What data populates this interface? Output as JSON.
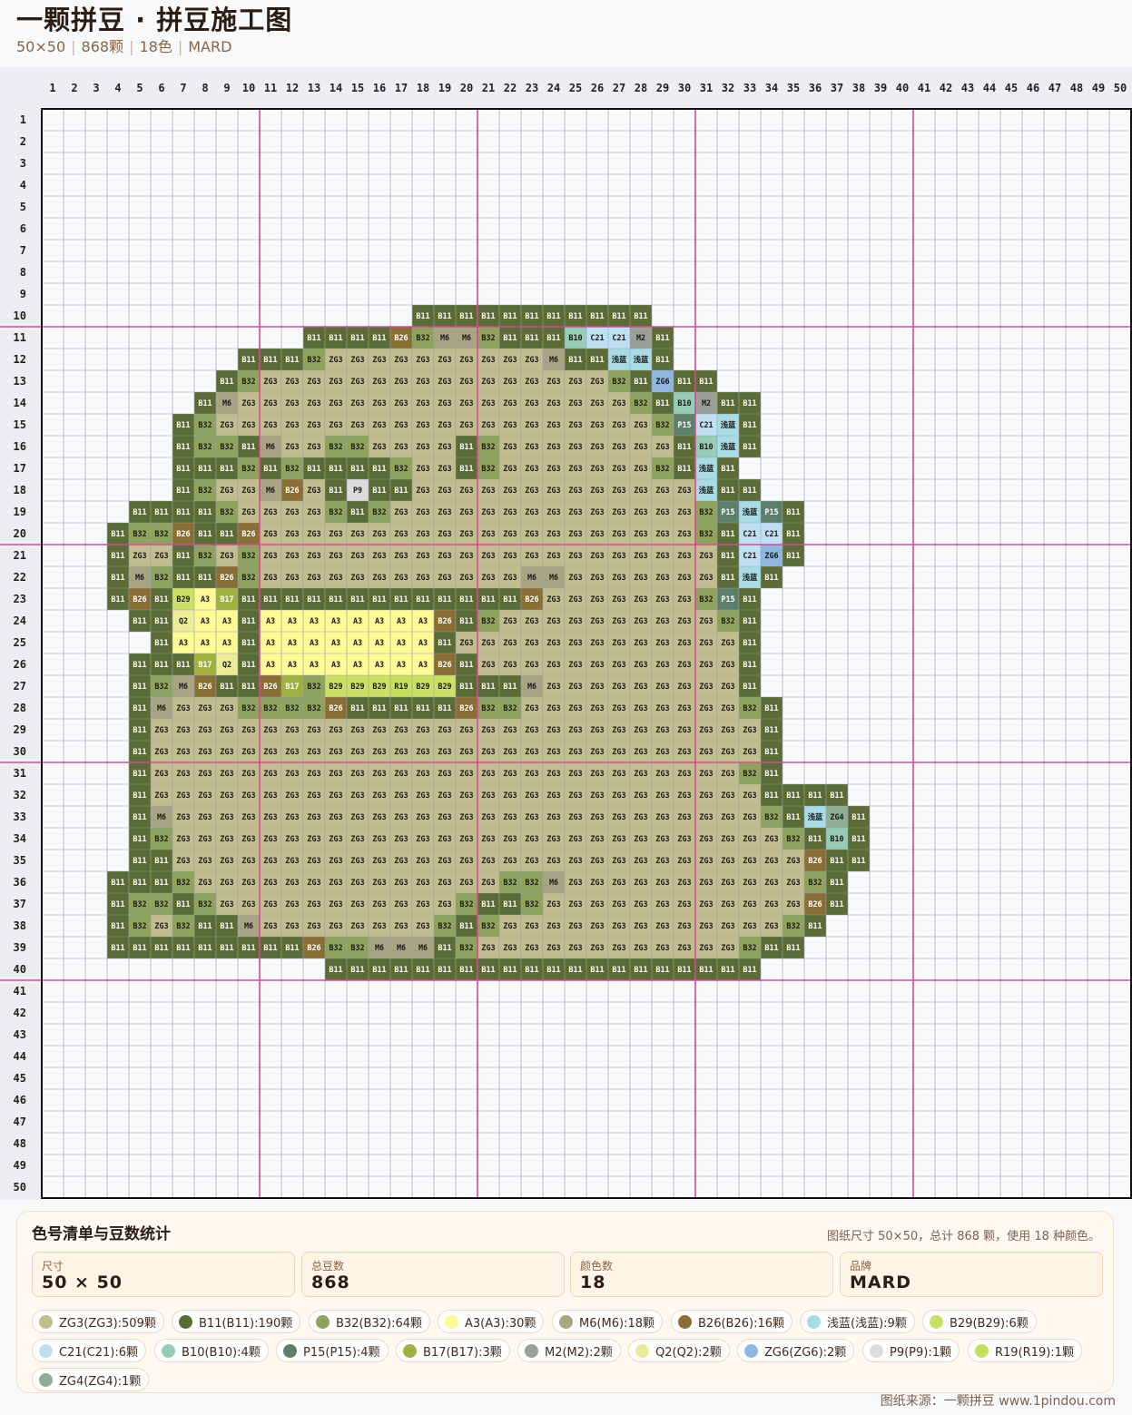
{
  "header": {
    "title": "一颗拼豆 · 拼豆施工图",
    "size": "50×50",
    "bead_count": "868颗",
    "color_count": "18色",
    "brand": "MARD"
  },
  "grid": {
    "cols": 50,
    "rows": 50,
    "major_every": 10,
    "rows_data": [
      {
        "r": 10,
        "c": 18,
        "cells": [
          "B11",
          "B11",
          "B11",
          "B11",
          "B11",
          "B11",
          "B11",
          "B11",
          "B11",
          "B11",
          "B11"
        ]
      },
      {
        "r": 11,
        "c": 13,
        "cells": [
          "B11",
          "B11",
          "B11",
          "B11",
          "B26",
          "B32",
          "M6",
          "M6",
          "B32",
          "B11",
          "B11",
          "B11",
          "B10",
          "C21",
          "C21",
          "M2",
          "B11"
        ]
      },
      {
        "r": 12,
        "c": 10,
        "cells": [
          "B11",
          "B11",
          "B11",
          "B32",
          "ZG3",
          "ZG3",
          "ZG3",
          "ZG3",
          "ZG3",
          "ZG3",
          "ZG3",
          "ZG3",
          "ZG3",
          "ZG3",
          "M6",
          "B11",
          "B11",
          "浅蓝",
          "浅蓝",
          "B11"
        ]
      },
      {
        "r": 13,
        "c": 9,
        "cells": [
          "B11",
          "B32",
          "ZG3",
          "ZG3",
          "ZG3",
          "ZG3",
          "ZG3",
          "ZG3",
          "ZG3",
          "ZG3",
          "ZG3",
          "ZG3",
          "ZG3",
          "ZG3",
          "ZG3",
          "ZG3",
          "ZG3",
          "ZG3",
          "B32",
          "B11",
          "ZG6",
          "B11",
          "B11"
        ]
      },
      {
        "r": 14,
        "c": 8,
        "cells": [
          "B11",
          "M6",
          "ZG3",
          "ZG3",
          "ZG3",
          "ZG3",
          "ZG3",
          "ZG3",
          "ZG3",
          "ZG3",
          "ZG3",
          "ZG3",
          "ZG3",
          "ZG3",
          "ZG3",
          "ZG3",
          "ZG3",
          "ZG3",
          "ZG3",
          "ZG3",
          "B32",
          "B11",
          "B10",
          "M2",
          "B11",
          "B11"
        ]
      },
      {
        "r": 15,
        "c": 7,
        "cells": [
          "B11",
          "B32",
          "ZG3",
          "ZG3",
          "ZG3",
          "ZG3",
          "ZG3",
          "ZG3",
          "ZG3",
          "ZG3",
          "ZG3",
          "ZG3",
          "ZG3",
          "ZG3",
          "ZG3",
          "ZG3",
          "ZG3",
          "ZG3",
          "ZG3",
          "ZG3",
          "ZG3",
          "ZG3",
          "B32",
          "P15",
          "C21",
          "浅蓝",
          "B11"
        ]
      },
      {
        "r": 16,
        "c": 7,
        "cells": [
          "B11",
          "B32",
          "B32",
          "B11",
          "M6",
          "ZG3",
          "ZG3",
          "B32",
          "B32",
          "ZG3",
          "ZG3",
          "ZG3",
          "ZG3",
          "B11",
          "B32",
          "ZG3",
          "ZG3",
          "ZG3",
          "ZG3",
          "ZG3",
          "ZG3",
          "ZG3",
          "ZG3",
          "B11",
          "B10",
          "浅蓝",
          "B11"
        ]
      },
      {
        "r": 17,
        "c": 7,
        "cells": [
          "B11",
          "B11",
          "B11",
          "B32",
          "B11",
          "B32",
          "B11",
          "B11",
          "B11",
          "B11",
          "B32",
          "ZG3",
          "ZG3",
          "B11",
          "B32",
          "ZG3",
          "ZG3",
          "ZG3",
          "ZG3",
          "ZG3",
          "ZG3",
          "ZG3",
          "B32",
          "B11",
          "浅蓝",
          "B11"
        ]
      },
      {
        "r": 18,
        "c": 7,
        "cells": [
          "B11",
          "B32",
          "ZG3",
          "ZG3",
          "M6",
          "B26",
          "ZG3",
          "B11",
          "P9",
          "B11",
          "B11",
          "ZG3",
          "ZG3",
          "ZG3",
          "ZG3",
          "ZG3",
          "ZG3",
          "ZG3",
          "ZG3",
          "ZG3",
          "ZG3",
          "ZG3",
          "ZG3",
          "ZG3",
          "浅蓝",
          "B11",
          "B11"
        ]
      },
      {
        "r": 19,
        "c": 5,
        "cells": [
          "B11",
          "B11",
          "B11",
          "B11",
          "B32",
          "ZG3",
          "ZG3",
          "ZG3",
          "ZG3",
          "B32",
          "B11",
          "B32",
          "ZG3",
          "ZG3",
          "ZG3",
          "ZG3",
          "ZG3",
          "ZG3",
          "ZG3",
          "ZG3",
          "ZG3",
          "ZG3",
          "ZG3",
          "ZG3",
          "ZG3",
          "ZG3",
          "B32",
          "P15",
          "浅蓝",
          "P15",
          "B11"
        ]
      },
      {
        "r": 20,
        "c": 4,
        "cells": [
          "B11",
          "B32",
          "B32",
          "B26",
          "B11",
          "B11",
          "B26",
          "ZG3",
          "ZG3",
          "ZG3",
          "ZG3",
          "ZG3",
          "ZG3",
          "ZG3",
          "ZG3",
          "ZG3",
          "ZG3",
          "ZG3",
          "ZG3",
          "ZG3",
          "ZG3",
          "ZG3",
          "ZG3",
          "ZG3",
          "ZG3",
          "ZG3",
          "ZG3",
          "B32",
          "B11",
          "C21",
          "C21",
          "B11"
        ]
      },
      {
        "r": 21,
        "c": 4,
        "cells": [
          "B11",
          "ZG3",
          "ZG3",
          "B11",
          "B32",
          "ZG3",
          "B32",
          "ZG3",
          "ZG3",
          "ZG3",
          "ZG3",
          "ZG3",
          "ZG3",
          "ZG3",
          "ZG3",
          "ZG3",
          "ZG3",
          "ZG3",
          "ZG3",
          "ZG3",
          "ZG3",
          "ZG3",
          "ZG3",
          "ZG3",
          "ZG3",
          "ZG3",
          "ZG3",
          "ZG3",
          "B11",
          "C21",
          "ZG6",
          "B11"
        ]
      },
      {
        "r": 22,
        "c": 4,
        "cells": [
          "B11",
          "M6",
          "B32",
          "B11",
          "B11",
          "B26",
          "B32",
          "ZG3",
          "ZG3",
          "ZG3",
          "ZG3",
          "ZG3",
          "ZG3",
          "ZG3",
          "ZG3",
          "ZG3",
          "ZG3",
          "ZG3",
          "ZG3",
          "M6",
          "M6",
          "ZG3",
          "ZG3",
          "ZG3",
          "ZG3",
          "ZG3",
          "ZG3",
          "ZG3",
          "B11",
          "浅蓝",
          "B11"
        ]
      },
      {
        "r": 23,
        "c": 4,
        "cells": [
          "B11",
          "B26",
          "B11",
          "B29",
          "A3",
          "B17",
          "B11",
          "B11",
          "B11",
          "B11",
          "B11",
          "B11",
          "B11",
          "B11",
          "B11",
          "B11",
          "B11",
          "B11",
          "B11",
          "B26",
          "ZG3",
          "ZG3",
          "ZG3",
          "ZG3",
          "ZG3",
          "ZG3",
          "ZG3",
          "B32",
          "P15",
          "B11"
        ]
      },
      {
        "r": 24,
        "c": 5,
        "cells": [
          "B11",
          "B11",
          "Q2",
          "A3",
          "A3",
          "B11",
          "A3",
          "A3",
          "A3",
          "A3",
          "A3",
          "A3",
          "A3",
          "A3",
          "B26",
          "B11",
          "B32",
          "ZG3",
          "ZG3",
          "ZG3",
          "ZG3",
          "ZG3",
          "ZG3",
          "ZG3",
          "ZG3",
          "ZG3",
          "ZG3",
          "B32",
          "B11"
        ]
      },
      {
        "r": 25,
        "c": 6,
        "cells": [
          "B11",
          "A3",
          "A3",
          "A3",
          "B11",
          "A3",
          "A3",
          "A3",
          "A3",
          "A3",
          "A3",
          "A3",
          "A3",
          "B11",
          "ZG3",
          "ZG3",
          "ZG3",
          "ZG3",
          "ZG3",
          "ZG3",
          "ZG3",
          "ZG3",
          "ZG3",
          "ZG3",
          "ZG3",
          "ZG3",
          "ZG3",
          "B11"
        ]
      },
      {
        "r": 26,
        "c": 5,
        "cells": [
          "B11",
          "B11",
          "B11",
          "B17",
          "Q2",
          "B11",
          "A3",
          "A3",
          "A3",
          "A3",
          "A3",
          "A3",
          "A3",
          "A3",
          "B26",
          "B11",
          "ZG3",
          "ZG3",
          "ZG3",
          "ZG3",
          "ZG3",
          "ZG3",
          "ZG3",
          "ZG3",
          "ZG3",
          "ZG3",
          "ZG3",
          "ZG3",
          "B11"
        ]
      },
      {
        "r": 27,
        "c": 5,
        "cells": [
          "B11",
          "B32",
          "M6",
          "B26",
          "B11",
          "B11",
          "B26",
          "B17",
          "B32",
          "B29",
          "B29",
          "B29",
          "R19",
          "B29",
          "B29",
          "B11",
          "B11",
          "B11",
          "M6",
          "ZG3",
          "ZG3",
          "ZG3",
          "ZG3",
          "ZG3",
          "ZG3",
          "ZG3",
          "ZG3",
          "ZG3",
          "B11"
        ]
      },
      {
        "r": 28,
        "c": 5,
        "cells": [
          "B11",
          "M6",
          "ZG3",
          "ZG3",
          "ZG3",
          "B32",
          "B32",
          "B32",
          "B32",
          "B26",
          "B11",
          "B11",
          "B11",
          "B11",
          "B11",
          "B26",
          "B32",
          "B32",
          "ZG3",
          "ZG3",
          "ZG3",
          "ZG3",
          "ZG3",
          "ZG3",
          "ZG3",
          "ZG3",
          "ZG3",
          "ZG3",
          "B32",
          "B11"
        ]
      },
      {
        "r": 29,
        "c": 5,
        "cells": [
          "B11",
          "ZG3",
          "ZG3",
          "ZG3",
          "ZG3",
          "ZG3",
          "ZG3",
          "ZG3",
          "ZG3",
          "ZG3",
          "ZG3",
          "ZG3",
          "ZG3",
          "ZG3",
          "ZG3",
          "ZG3",
          "ZG3",
          "ZG3",
          "ZG3",
          "ZG3",
          "ZG3",
          "ZG3",
          "ZG3",
          "ZG3",
          "ZG3",
          "ZG3",
          "ZG3",
          "ZG3",
          "ZG3",
          "B11"
        ]
      },
      {
        "r": 30,
        "c": 5,
        "cells": [
          "B11",
          "ZG3",
          "ZG3",
          "ZG3",
          "ZG3",
          "ZG3",
          "ZG3",
          "ZG3",
          "ZG3",
          "ZG3",
          "ZG3",
          "ZG3",
          "ZG3",
          "ZG3",
          "ZG3",
          "ZG3",
          "ZG3",
          "ZG3",
          "ZG3",
          "ZG3",
          "ZG3",
          "ZG3",
          "ZG3",
          "ZG3",
          "ZG3",
          "ZG3",
          "ZG3",
          "ZG3",
          "ZG3",
          "B11"
        ]
      },
      {
        "r": 31,
        "c": 5,
        "cells": [
          "B11",
          "ZG3",
          "ZG3",
          "ZG3",
          "ZG3",
          "ZG3",
          "ZG3",
          "ZG3",
          "ZG3",
          "ZG3",
          "ZG3",
          "ZG3",
          "ZG3",
          "ZG3",
          "ZG3",
          "ZG3",
          "ZG3",
          "ZG3",
          "ZG3",
          "ZG3",
          "ZG3",
          "ZG3",
          "ZG3",
          "ZG3",
          "ZG3",
          "ZG3",
          "ZG3",
          "ZG3",
          "B32",
          "B11"
        ]
      },
      {
        "r": 32,
        "c": 5,
        "cells": [
          "B11",
          "ZG3",
          "ZG3",
          "ZG3",
          "ZG3",
          "ZG3",
          "ZG3",
          "ZG3",
          "ZG3",
          "ZG3",
          "ZG3",
          "ZG3",
          "ZG3",
          "ZG3",
          "ZG3",
          "ZG3",
          "ZG3",
          "ZG3",
          "ZG3",
          "ZG3",
          "ZG3",
          "ZG3",
          "ZG3",
          "ZG3",
          "ZG3",
          "ZG3",
          "ZG3",
          "ZG3",
          "ZG3",
          "B11",
          "B11",
          "B11",
          "B11"
        ]
      },
      {
        "r": 33,
        "c": 5,
        "cells": [
          "B11",
          "M6",
          "ZG3",
          "ZG3",
          "ZG3",
          "ZG3",
          "ZG3",
          "ZG3",
          "ZG3",
          "ZG3",
          "ZG3",
          "ZG3",
          "ZG3",
          "ZG3",
          "ZG3",
          "ZG3",
          "ZG3",
          "ZG3",
          "ZG3",
          "ZG3",
          "ZG3",
          "ZG3",
          "ZG3",
          "ZG3",
          "ZG3",
          "ZG3",
          "ZG3",
          "ZG3",
          "ZG3",
          "B32",
          "B11",
          "浅蓝",
          "ZG4",
          "B11"
        ]
      },
      {
        "r": 34,
        "c": 5,
        "cells": [
          "B11",
          "B32",
          "ZG3",
          "ZG3",
          "ZG3",
          "ZG3",
          "ZG3",
          "ZG3",
          "ZG3",
          "ZG3",
          "ZG3",
          "ZG3",
          "ZG3",
          "ZG3",
          "ZG3",
          "ZG3",
          "ZG3",
          "ZG3",
          "ZG3",
          "ZG3",
          "ZG3",
          "ZG3",
          "ZG3",
          "ZG3",
          "ZG3",
          "ZG3",
          "ZG3",
          "ZG3",
          "ZG3",
          "ZG3",
          "B32",
          "B11",
          "B10",
          "B11"
        ]
      },
      {
        "r": 35,
        "c": 5,
        "cells": [
          "B11",
          "B11",
          "ZG3",
          "ZG3",
          "ZG3",
          "ZG3",
          "ZG3",
          "ZG3",
          "ZG3",
          "ZG3",
          "ZG3",
          "ZG3",
          "ZG3",
          "ZG3",
          "ZG3",
          "ZG3",
          "ZG3",
          "ZG3",
          "ZG3",
          "ZG3",
          "ZG3",
          "ZG3",
          "ZG3",
          "ZG3",
          "ZG3",
          "ZG3",
          "ZG3",
          "ZG3",
          "ZG3",
          "ZG3",
          "ZG3",
          "B26",
          "B11",
          "B11"
        ]
      },
      {
        "r": 36,
        "c": 4,
        "cells": [
          "B11",
          "B11",
          "B11",
          "B32",
          "ZG3",
          "ZG3",
          "ZG3",
          "ZG3",
          "ZG3",
          "ZG3",
          "ZG3",
          "ZG3",
          "ZG3",
          "ZG3",
          "ZG3",
          "ZG3",
          "ZG3",
          "ZG3",
          "B32",
          "B32",
          "M6",
          "ZG3",
          "ZG3",
          "ZG3",
          "ZG3",
          "ZG3",
          "ZG3",
          "ZG3",
          "ZG3",
          "ZG3",
          "ZG3",
          "ZG3",
          "B32",
          "B11"
        ]
      },
      {
        "r": 37,
        "c": 4,
        "cells": [
          "B11",
          "B32",
          "B32",
          "B11",
          "B32",
          "ZG3",
          "ZG3",
          "ZG3",
          "ZG3",
          "ZG3",
          "ZG3",
          "ZG3",
          "ZG3",
          "ZG3",
          "ZG3",
          "ZG3",
          "B32",
          "B11",
          "B11",
          "B32",
          "ZG3",
          "ZG3",
          "ZG3",
          "ZG3",
          "ZG3",
          "ZG3",
          "ZG3",
          "ZG3",
          "ZG3",
          "ZG3",
          "ZG3",
          "ZG3",
          "B26",
          "B11"
        ]
      },
      {
        "r": 38,
        "c": 4,
        "cells": [
          "B11",
          "B32",
          "ZG3",
          "B32",
          "B11",
          "B11",
          "M6",
          "ZG3",
          "ZG3",
          "ZG3",
          "ZG3",
          "ZG3",
          "ZG3",
          "ZG3",
          "ZG3",
          "B32",
          "B11",
          "B32",
          "ZG3",
          "ZG3",
          "ZG3",
          "ZG3",
          "ZG3",
          "ZG3",
          "ZG3",
          "ZG3",
          "ZG3",
          "ZG3",
          "ZG3",
          "ZG3",
          "ZG3",
          "B32",
          "B11"
        ]
      },
      {
        "r": 39,
        "c": 4,
        "cells": [
          "B11",
          "B11",
          "B11",
          "B11",
          "B11",
          "B11",
          "B11",
          "B11",
          "B11",
          "B26",
          "B32",
          "B32",
          "M6",
          "M6",
          "M6",
          "B11",
          "B32",
          "ZG3",
          "ZG3",
          "ZG3",
          "ZG3",
          "ZG3",
          "ZG3",
          "ZG3",
          "ZG3",
          "ZG3",
          "ZG3",
          "ZG3",
          "ZG3",
          "B32",
          "B11",
          "B11"
        ]
      },
      {
        "r": 40,
        "c": 14,
        "cells": [
          "B11",
          "B11",
          "B11",
          "B11",
          "B11",
          "B11",
          "B11",
          "B11",
          "B11",
          "B11",
          "B11",
          "B11",
          "B11",
          "B11",
          "B11",
          "B11",
          "B11",
          "B11",
          "B11",
          "B11"
        ]
      }
    ]
  },
  "colors": {
    "ZG3": "#c2bd8f",
    "B11": "#5b6b35",
    "B32": "#8ea35e",
    "A3": "#fffa96",
    "M6": "#a8a585",
    "B26": "#8a6e33",
    "浅蓝": "#a7dce6",
    "B29": "#cbe064",
    "C21": "#bfe0f3",
    "B10": "#96cdb7",
    "P15": "#5b7f6b",
    "B17": "#a0b13f",
    "M2": "#9a9f98",
    "Q2": "#ecec98",
    "ZG6": "#8fb7e0",
    "P9": "#dcdcdc",
    "R19": "#c5e05c",
    "ZG4": "#8fae96"
  },
  "light_text_codes": [
    "B11",
    "B26",
    "P15",
    "B17"
  ],
  "summary": {
    "title": "色号清单与豆数统计",
    "note": "图纸尺寸 50×50，总计 868 颗，使用 18 种颜色。",
    "stats": [
      {
        "label": "尺寸",
        "value": "50 × 50"
      },
      {
        "label": "总豆数",
        "value": "868"
      },
      {
        "label": "颜色数",
        "value": "18"
      },
      {
        "label": "品牌",
        "value": "MARD"
      }
    ],
    "palette": [
      {
        "code": "ZG3",
        "text": "ZG3(ZG3):509颗"
      },
      {
        "code": "B11",
        "text": "B11(B11):190颗"
      },
      {
        "code": "B32",
        "text": "B32(B32):64颗"
      },
      {
        "code": "A3",
        "text": "A3(A3):30颗"
      },
      {
        "code": "M6",
        "text": "M6(M6):18颗"
      },
      {
        "code": "B26",
        "text": "B26(B26):16颗"
      },
      {
        "code": "浅蓝",
        "text": "浅蓝(浅蓝):9颗"
      },
      {
        "code": "B29",
        "text": "B29(B29):6颗"
      },
      {
        "code": "C21",
        "text": "C21(C21):6颗"
      },
      {
        "code": "B10",
        "text": "B10(B10):4颗"
      },
      {
        "code": "P15",
        "text": "P15(P15):4颗"
      },
      {
        "code": "B17",
        "text": "B17(B17):3颗"
      },
      {
        "code": "M2",
        "text": "M2(M2):2颗"
      },
      {
        "code": "Q2",
        "text": "Q2(Q2):2颗"
      },
      {
        "code": "ZG6",
        "text": "ZG6(ZG6):2颗"
      },
      {
        "code": "P9",
        "text": "P9(P9):1颗"
      },
      {
        "code": "R19",
        "text": "R19(R19):1颗"
      },
      {
        "code": "ZG4",
        "text": "ZG4(ZG4):1颗"
      }
    ]
  },
  "footer": "图纸来源：一颗拼豆 www.1pindou.com"
}
